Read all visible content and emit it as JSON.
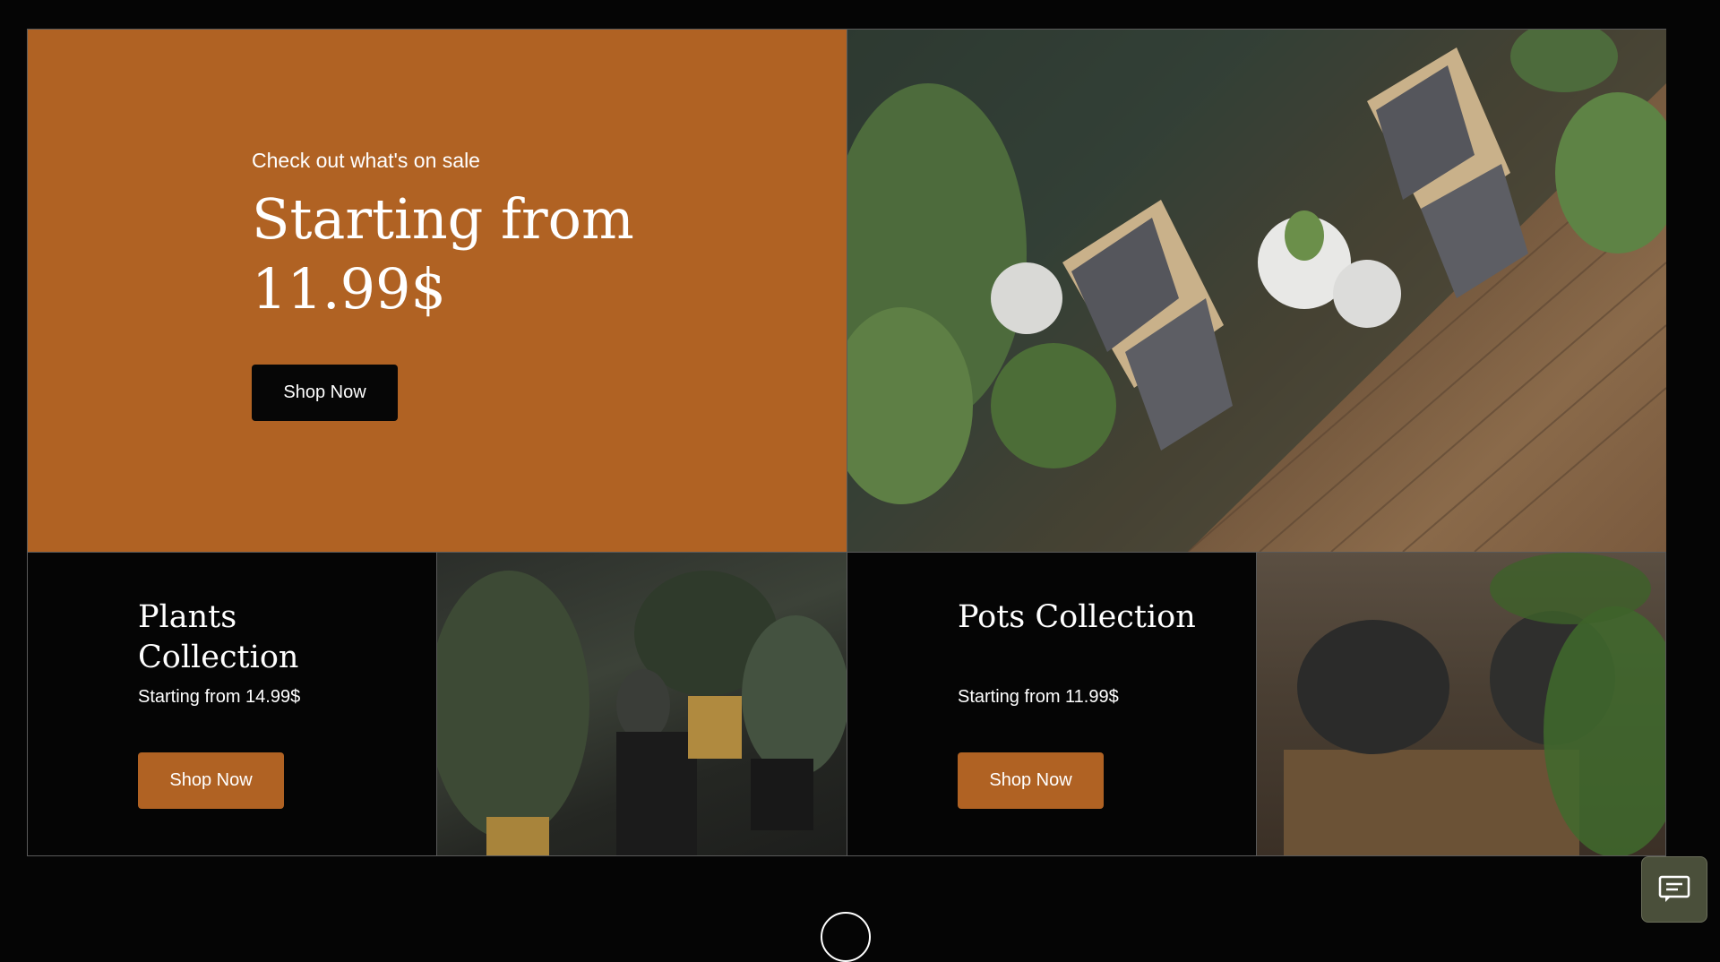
{
  "hero": {
    "kicker": "Check out what's on sale",
    "headline": "Starting from 11.99$",
    "button_label": "Shop Now",
    "image_alt": "Interior with plants and chairs"
  },
  "collections": [
    {
      "title": "Plants Collection",
      "subtitle": "Starting from 14.99$",
      "button_label": "Shop Now",
      "image_alt": "Potted plants"
    },
    {
      "title": "Pots Collection",
      "subtitle": "Starting from 11.99$",
      "button_label": "Shop Now",
      "image_alt": "Ceramic pots"
    }
  ],
  "colors": {
    "rust": "#b06223",
    "background": "#050505",
    "chat": "#4a4f3a"
  },
  "icons": {
    "chat": "chat-icon",
    "scroll": "scroll-down-icon"
  }
}
